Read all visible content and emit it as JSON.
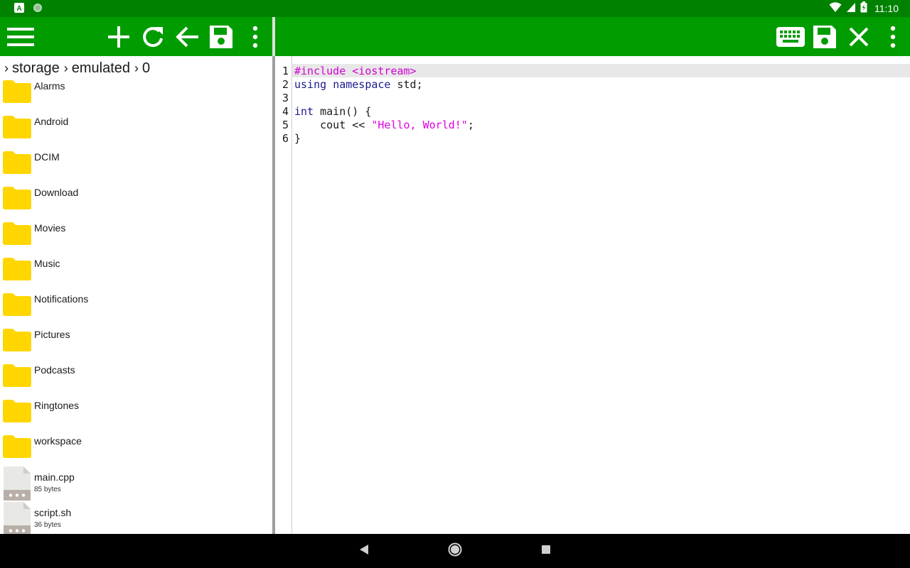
{
  "colors": {
    "status_bar": "#008200",
    "toolbar": "#009c00",
    "folder": "#ffd600",
    "preprocessor": "#d400d4",
    "keyword": "#1a1a8c",
    "string": "#e000e0"
  },
  "status_bar": {
    "notification_icons": [
      "a-letter-icon",
      "circle-status-icon"
    ],
    "system_icons": [
      "wifi-icon",
      "signal-icon",
      "battery-icon"
    ],
    "time": "11:10"
  },
  "left_toolbar": {
    "buttons": [
      "menu-icon",
      "add-icon",
      "refresh-icon",
      "back-arrow-icon",
      "save-icon",
      "more-vert-icon"
    ]
  },
  "right_toolbar": {
    "buttons": [
      "keyboard-icon",
      "save-icon",
      "close-icon",
      "more-vert-icon"
    ]
  },
  "breadcrumb": {
    "separator": "›",
    "parts": [
      "storage",
      "emulated",
      "0"
    ]
  },
  "files": [
    {
      "name": "Alarms",
      "type": "folder"
    },
    {
      "name": "Android",
      "type": "folder"
    },
    {
      "name": "DCIM",
      "type": "folder"
    },
    {
      "name": "Download",
      "type": "folder"
    },
    {
      "name": "Movies",
      "type": "folder"
    },
    {
      "name": "Music",
      "type": "folder"
    },
    {
      "name": "Notifications",
      "type": "folder"
    },
    {
      "name": "Pictures",
      "type": "folder"
    },
    {
      "name": "Podcasts",
      "type": "folder"
    },
    {
      "name": "Ringtones",
      "type": "folder"
    },
    {
      "name": "workspace",
      "type": "folder"
    },
    {
      "name": "main.cpp",
      "type": "file",
      "size": "85 bytes"
    },
    {
      "name": "script.sh",
      "type": "file",
      "size": "36 bytes"
    }
  ],
  "editor": {
    "current_line": 1,
    "lines": [
      {
        "number": "1",
        "tokens": [
          {
            "text": "#include <iostream>",
            "kind": "pre"
          }
        ]
      },
      {
        "number": "2",
        "tokens": [
          {
            "text": "using",
            "kind": "kw"
          },
          {
            "text": " ",
            "kind": "plain"
          },
          {
            "text": "namespace",
            "kind": "kw"
          },
          {
            "text": " std;",
            "kind": "plain"
          }
        ]
      },
      {
        "number": "3",
        "tokens": []
      },
      {
        "number": "4",
        "tokens": [
          {
            "text": "int",
            "kind": "kw"
          },
          {
            "text": " main() {",
            "kind": "plain"
          }
        ]
      },
      {
        "number": "5",
        "tokens": [
          {
            "text": "    cout << ",
            "kind": "plain"
          },
          {
            "text": "\"Hello, World!\"",
            "kind": "str"
          },
          {
            "text": ";",
            "kind": "plain"
          }
        ]
      },
      {
        "number": "6",
        "tokens": [
          {
            "text": "}",
            "kind": "plain"
          }
        ]
      }
    ]
  },
  "nav_bar": {
    "buttons": [
      "back-triangle-icon",
      "home-circle-icon",
      "recents-square-icon"
    ]
  }
}
